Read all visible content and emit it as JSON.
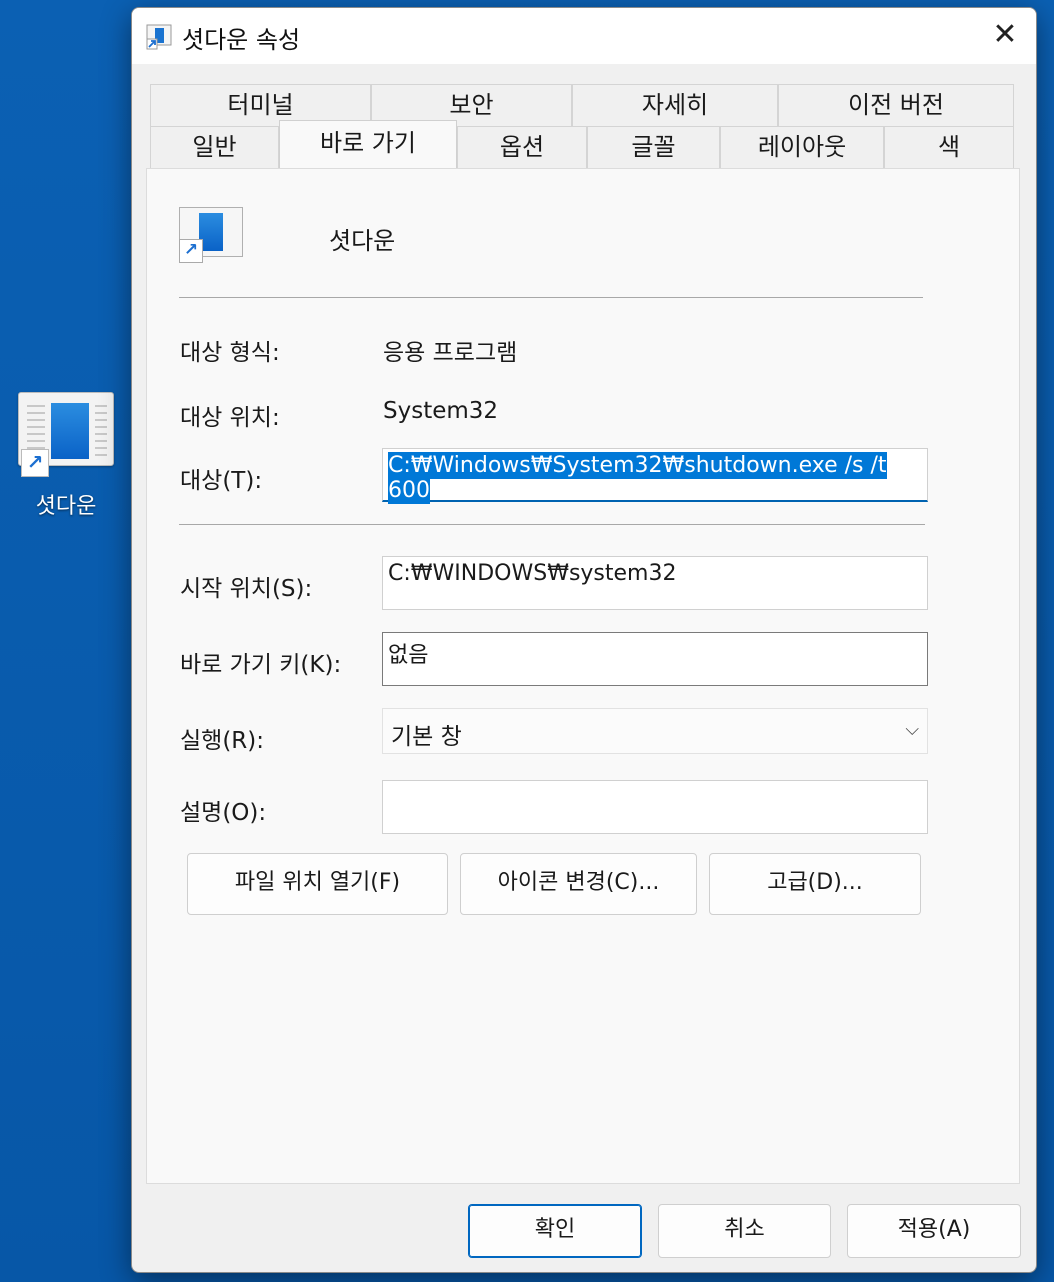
{
  "desktop": {
    "icon_label": "셧다운"
  },
  "window": {
    "title": "셧다운  속성",
    "close_glyph": "✕"
  },
  "tabs": {
    "row1": [
      "터미널",
      "보안",
      "자세히",
      "이전 버전"
    ],
    "row2": [
      "일반",
      "바로 가기",
      "옵션",
      "글꼴",
      "레이아웃",
      "색"
    ],
    "active": "바로 가기"
  },
  "shortcut": {
    "name": "셧다운",
    "target_type_label": "대상 형식:",
    "target_type_value": "응용 프로그램",
    "target_location_label": "대상 위치:",
    "target_location_value": "System32",
    "target_label": "대상(T):",
    "target_value": "C:₩Windows₩System32₩shutdown.exe /s /t 600",
    "start_in_label": "시작 위치(S):",
    "start_in_value": "C:₩WINDOWS₩system32",
    "shortcut_key_label": "바로 가기 키(K):",
    "shortcut_key_value": "없음",
    "run_label": "실행(R):",
    "run_value": "기본 창",
    "comment_label": "설명(O):",
    "comment_value": ""
  },
  "actions": {
    "open_location": "파일 위치 열기(F)",
    "change_icon": "아이콘 변경(C)...",
    "advanced": "고급(D)..."
  },
  "footer": {
    "ok": "확인",
    "cancel": "취소",
    "apply": "적용(A)"
  },
  "colors": {
    "desktop_bg": "#0757a7",
    "accent": "#0078d7"
  }
}
